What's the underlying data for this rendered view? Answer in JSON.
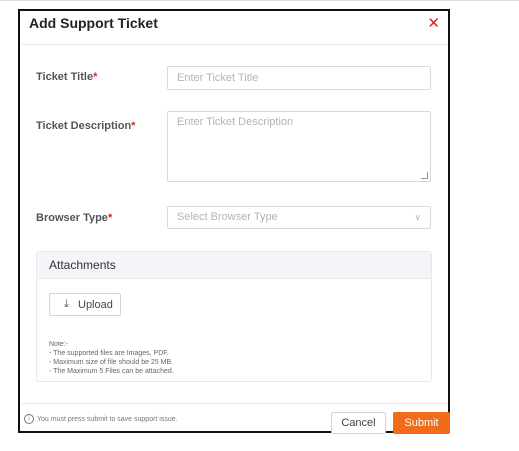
{
  "modal": {
    "title": "Add Support Ticket",
    "close_glyph": "✕"
  },
  "form": {
    "ticket_title": {
      "label": "Ticket Title",
      "required_mark": "*",
      "placeholder": "Enter Ticket Title",
      "value": ""
    },
    "ticket_description": {
      "label": "Ticket Description",
      "required_mark": "*",
      "placeholder": "Enter Ticket Description",
      "value": ""
    },
    "browser_type": {
      "label": "Browser Type",
      "required_mark": "*",
      "placeholder": "Select Browser Type",
      "selected": ""
    }
  },
  "attachments": {
    "title": "Attachments",
    "upload_label": "Upload",
    "notes": [
      "Note:-",
      "- The supported files are Images, PDF.",
      "- Maximum size of file should be 25 MB.",
      "- The Maximum 5 Files can be attached."
    ]
  },
  "footer": {
    "note": "You must press submit to save support issue.",
    "cancel_label": "Cancel",
    "submit_label": "Submit"
  },
  "colors": {
    "accent": "#f06b1a",
    "required": "#e0241b",
    "close": "#e0241b"
  },
  "icons": {
    "close": "close-icon",
    "upload": "upload-icon",
    "dropdown": "chevron-down-icon",
    "info": "info-icon"
  }
}
